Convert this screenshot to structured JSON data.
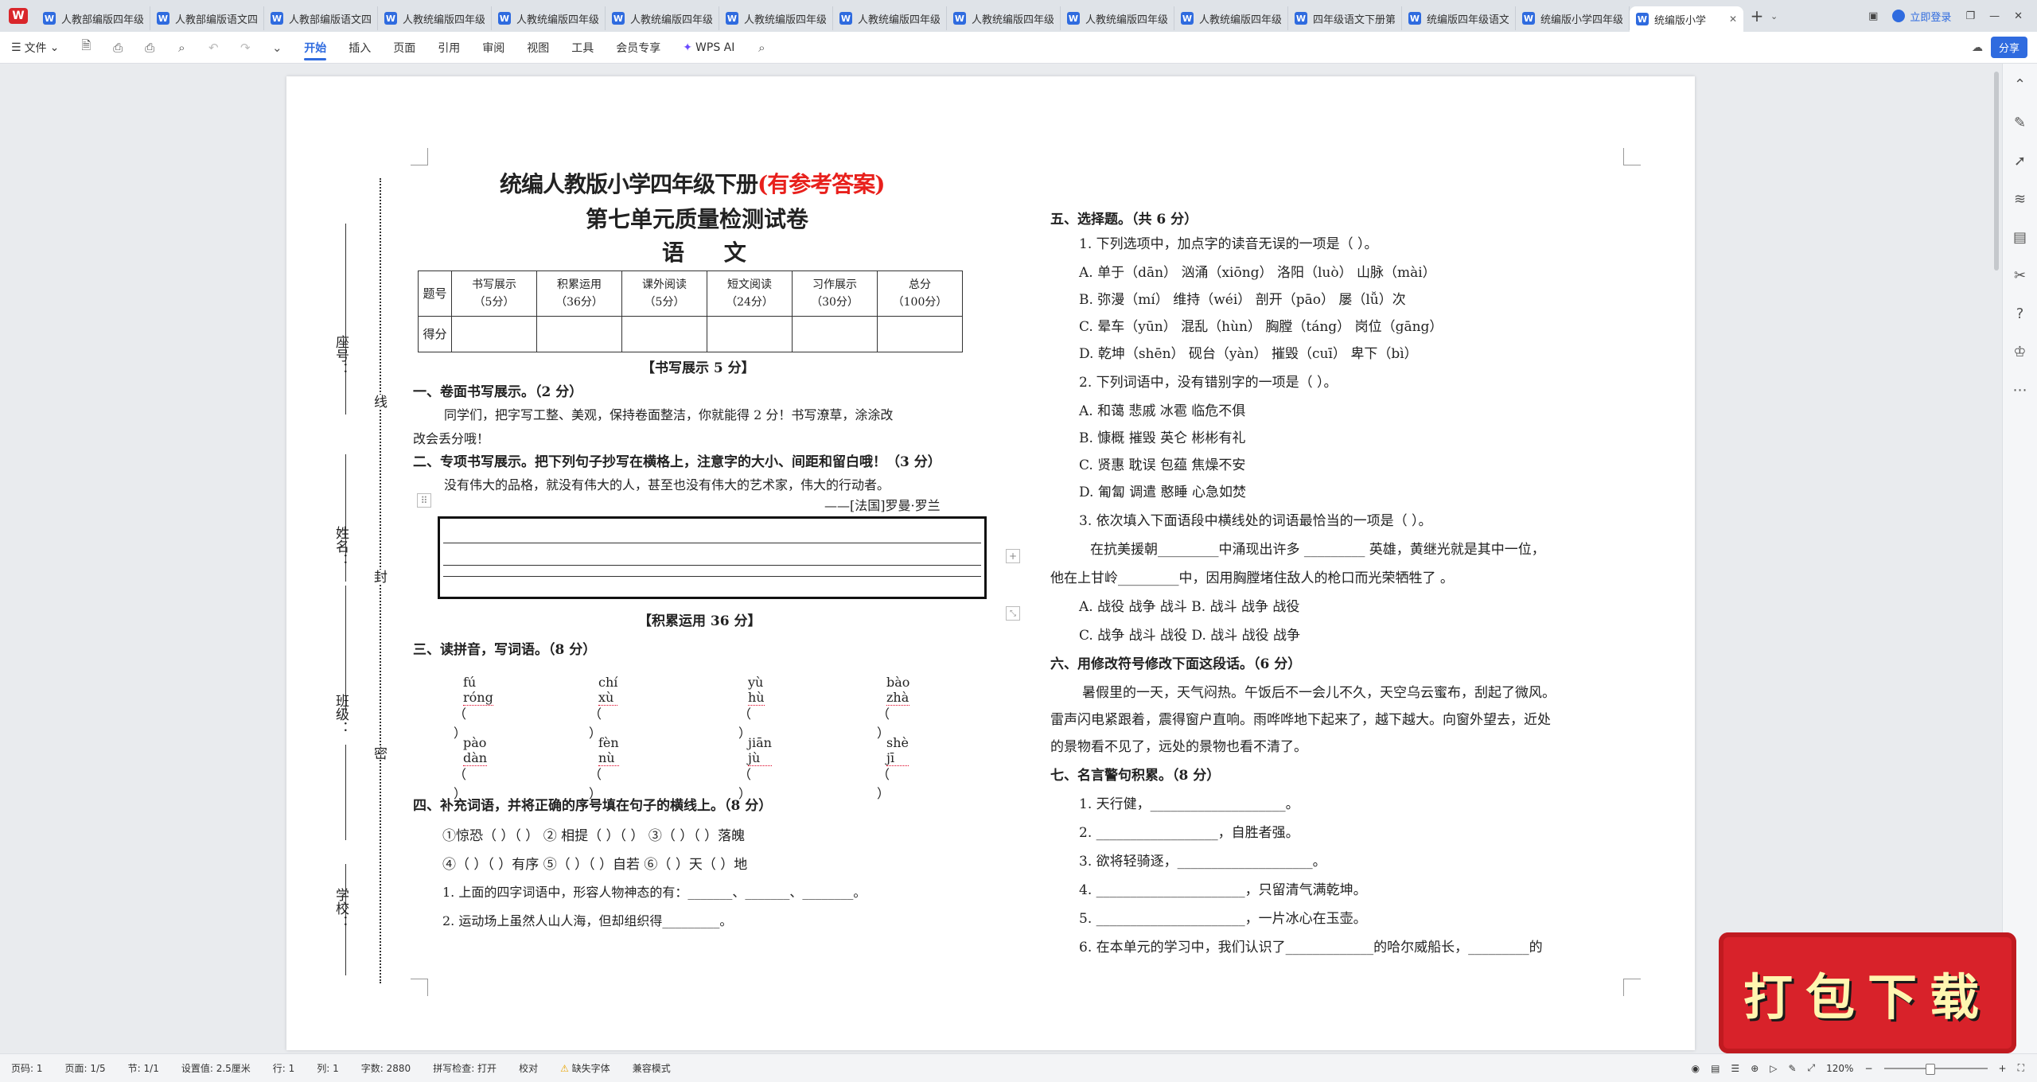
{
  "tabbar": {
    "tabs": [
      {
        "label": "人教部编版四年级"
      },
      {
        "label": "人教部编版语文四"
      },
      {
        "label": "人教部编版语文四"
      },
      {
        "label": "人教统编版四年级"
      },
      {
        "label": "人教统编版四年级"
      },
      {
        "label": "人教统编版四年级"
      },
      {
        "label": "人教统编版四年级"
      },
      {
        "label": "人教统编版四年级"
      },
      {
        "label": "人教统编版四年级"
      },
      {
        "label": "人教统编版四年级"
      },
      {
        "label": "人教统编版四年级"
      },
      {
        "label": "四年级语文下册第"
      },
      {
        "label": "统编版四年级语文"
      },
      {
        "label": "统编版小学四年级"
      },
      {
        "label": "统编版小学"
      }
    ],
    "login": "立即登录"
  },
  "ribbon": {
    "file": "文件",
    "tabs": [
      "开始",
      "插入",
      "页面",
      "引用",
      "审阅",
      "视图",
      "工具",
      "会员专享"
    ],
    "ai": "WPS AI",
    "share": "分享"
  },
  "doc": {
    "title_main": "统编人教版小学四年级下册",
    "title_red": "(有参考答案)",
    "title2": "第七单元质量检测试卷",
    "title3": "语 文",
    "score_table": {
      "headers": [
        "题号",
        "书写展示\n（5分）",
        "积累运用\n（36分）",
        "课外阅读\n（5分）",
        "短文阅读\n（24分）",
        "习作展示\n（30分）",
        "总分\n（100分）"
      ],
      "row_label": "得分"
    },
    "side_labels": [
      "座号：",
      "姓名：",
      "班级：",
      "学校："
    ],
    "cut_labels": [
      "线",
      "封",
      "密"
    ],
    "s_write_header": "【书写展示 5 分】",
    "s1_title": "一、卷面书写展示。（2 分）",
    "s1_text1": "同学们，把字写工整、美观，保持卷面整洁，你就能得 2 分！书写潦草，涂涂改",
    "s1_text2": "改会丢分哦！",
    "s2_title": "二、专项书写展示。把下列句子抄写在横格上，注意字的大小、间距和留白哦！（3 分）",
    "s2_quote": "没有伟大的品格，就没有伟大的人，甚至也没有伟大的艺术家，伟大的行动者。",
    "s2_author": "——[法国]罗曼·罗兰",
    "s_acc_header": "【积累运用 36 分】",
    "s3_title": "三、读拼音，写词语。（8 分）",
    "pinyin_row1": [
      "fú  róng",
      "chí  xù",
      "yù  hù",
      "bào  zhà"
    ],
    "pinyin_row2": [
      "pào  dàn",
      "fèn nù",
      "jiān  jù",
      "shè  jī"
    ],
    "paren": "（          ）",
    "s4_title": "四、补充词语，并将正确的序号填在句子的横线上。（8 分）",
    "s4_line1": "①惊恐（   ）（   ）  ② 相提（   ）（   ）  ③（   ）（   ）落魄",
    "s4_line2": "④（   ）（   ）有序   ⑤（   ）（   ）自若  ⑥（   ）天（   ）地",
    "s4_q1": "1. 上面的四字词语中，形容人物神态的有：_______、_______、________。",
    "s4_q2": "2. 运动场上虽然人山人海，但却组织得_________。",
    "s5_title": "五、选择题。（共 6 分）",
    "s5_q1": "1. 下列选项中，加点字的读音无误的一项是（      ）。",
    "s5_q1_opts": [
      "A. 单于（dān）   汹涌（xiōng）      洛阳（luò）       山脉（mài）",
      "B. 弥漫（mí）    维持（wéi）       剖开（pāo）       屡（lǚ）次",
      "C. 晕车（yūn）   混乱（hùn）       胸膛（táng）      岗位（gāng）",
      "D. 乾坤（shēn）  砚台（yàn）       摧毁（cuī）       卑下（bì）"
    ],
    "s5_q2": "2. 下列词语中，没有错别字的一项是（    ）。",
    "s5_q2_opts": [
      "A. 和蔼        悲戚         冰雹         临危不俱",
      "B. 慷概        摧毁         英仑         彬彬有礼",
      "C. 贤惠        耽误         包蕴         焦燥不安",
      "D. 匍匐        调遣         憨睡         心急如焚"
    ],
    "s5_q3": "3. 依次填入下面语段中横线处的词语最恰当的一项是（      ）。",
    "s5_q3_text1": "在抗美援朝_________中涌现出许多 _________ 英雄，黄继光就是其中一位，",
    "s5_q3_text2": "他在上甘岭_________中，因用胸膛堵住敌人的枪口而光荣牺牲了 。",
    "s5_q3_opts": [
      "A. 战役  战争  战斗        B. 战斗  战争  战役",
      "C. 战争  战斗  战役        D. 战斗  战役  战争"
    ],
    "s6_title": "六、用修改符号修改下面这段话。（6 分）",
    "s6_text1": "暑假里的一天，天气闷热。午饭后不一会儿不久，天空乌云蜜布，刮起了微风。",
    "s6_text2": "雷声闪电紧跟着，震得窗户直响。雨哗哗地下起来了，越下越大。向窗外望去，近处",
    "s6_text3": "的景物看不见了，远处的景物也看不清了。",
    "s7_title": "七、名言警句积累。（8 分）",
    "s7_items": [
      "1. 天行健，____________________。",
      "2. __________________，自胜者强。",
      "3. 欲将轻骑逐，____________________。",
      "4. ______________________，只留清气满乾坤。",
      "5. ______________________，一片冰心在玉壶。",
      "6. 在本单元的学习中，我们认识了_____________的哈尔威船长，_________的"
    ]
  },
  "statusbar": {
    "page": "页码: 1",
    "pages": "页面: 1/5",
    "section": "节: 1/1",
    "setting": "设置值: 2.5厘米",
    "row": "行: 1",
    "col": "列: 1",
    "words": "字数: 2880",
    "spell": "拼写检查: 打开",
    "proof": "校对",
    "font_missing": "缺失字体",
    "compat": "兼容模式",
    "zoom": "120%"
  },
  "promo": {
    "label": "打包下载"
  }
}
